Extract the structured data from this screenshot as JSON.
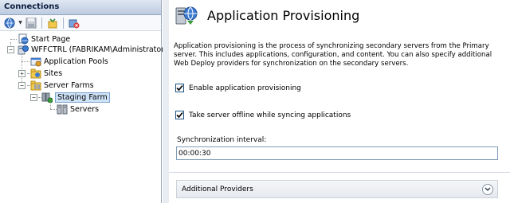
{
  "connections": {
    "title": "Connections",
    "toolbar": {
      "icons": [
        "connect-globe-icon",
        "save-icon",
        "new-connection-icon",
        "disconnect-icon"
      ]
    },
    "tree": [
      {
        "label": "Start Page",
        "icon": "start-page-icon"
      },
      {
        "label": "WFFCTRL (FABRIKAM\\Administrator)",
        "icon": "server-icon"
      },
      {
        "label": "Application Pools",
        "icon": "app-pools-icon"
      },
      {
        "label": "Sites",
        "icon": "sites-icon"
      },
      {
        "label": "Server Farms",
        "icon": "server-farms-icon"
      },
      {
        "label": "Staging Farm",
        "icon": "staging-farm-icon"
      },
      {
        "label": "Servers",
        "icon": "servers-icon"
      }
    ]
  },
  "main": {
    "title": "Application Provisioning",
    "description": "Application provisioning is the process of synchronizing secondary servers from the Primary server. This includes applications, configuration, and content. You can also specify additional Web Deploy providers for synchronization on the secondary servers.",
    "checkbox_enable": {
      "label": "Enable application provisioning",
      "checked": true
    },
    "checkbox_offline": {
      "label": "Take server offline while syncing applications",
      "checked": true
    },
    "sync": {
      "label": "Synchronization interval:",
      "value": "00:00:30"
    },
    "section": {
      "label": "Additional Providers"
    }
  },
  "colors": {
    "selection": "#cfe3f8",
    "pane_header": "#bdcbe0",
    "content_bg": "#e9ecf0"
  }
}
